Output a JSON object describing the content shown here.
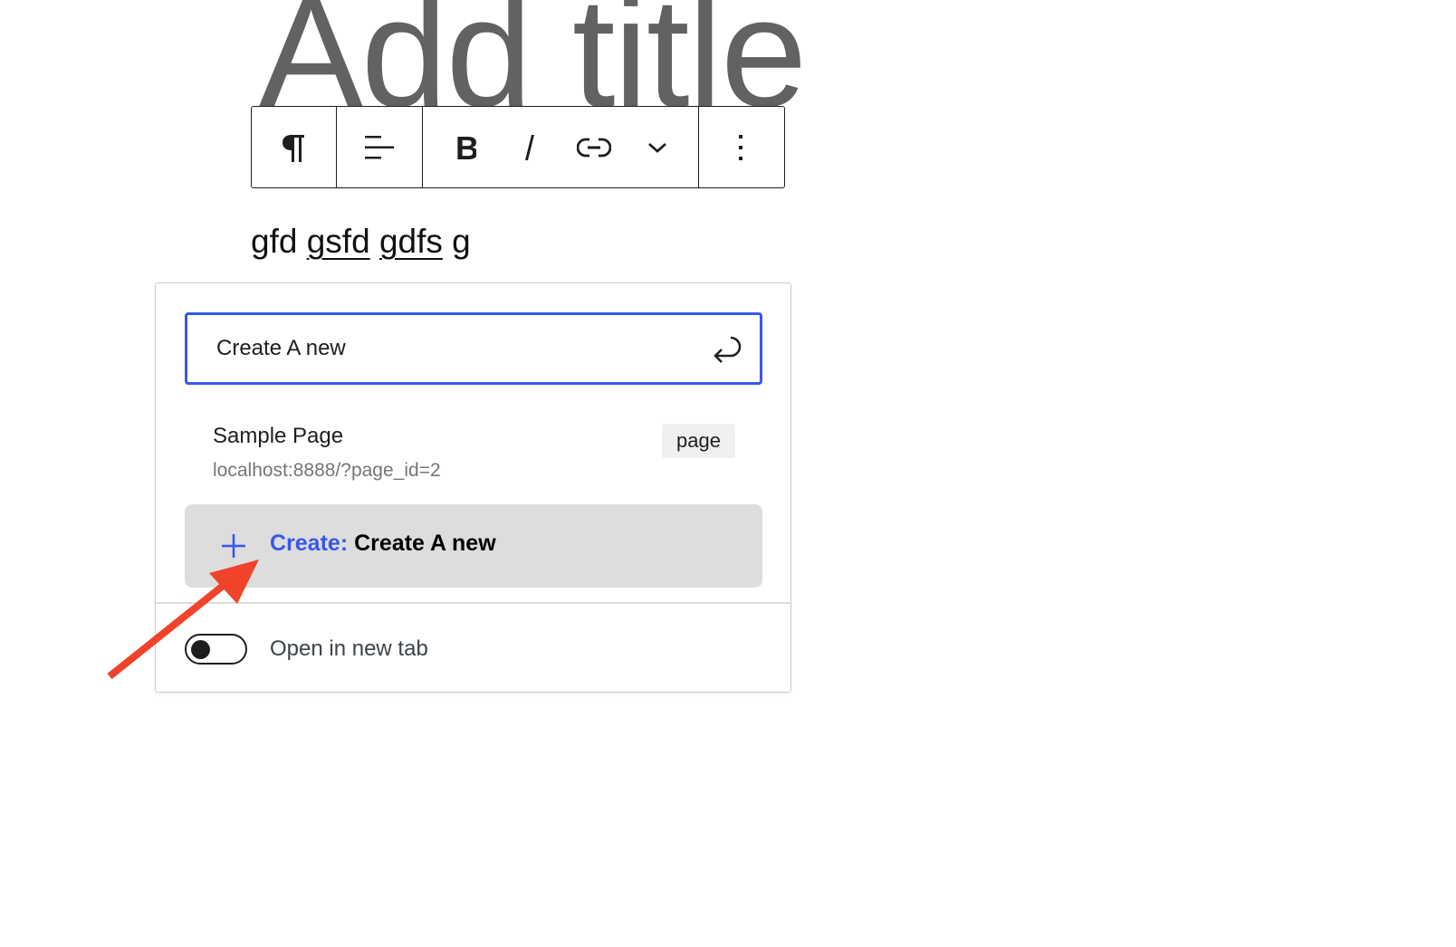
{
  "editor": {
    "title_placeholder": "Add title",
    "paragraph": {
      "segments": [
        {
          "text": "gfd ",
          "link": false
        },
        {
          "text": "gsfd",
          "link": true
        },
        {
          "text": " ",
          "link": false
        },
        {
          "text": "gdfs",
          "link": true
        },
        {
          "text": " g",
          "link": false
        }
      ]
    }
  },
  "toolbar": {
    "groups": [
      {
        "items": [
          {
            "icon": "paragraph-icon",
            "label": "Paragraph"
          }
        ]
      },
      {
        "items": [
          {
            "icon": "align-left-icon",
            "label": "Align text"
          }
        ]
      },
      {
        "items": [
          {
            "icon": "bold-icon",
            "label": "Bold"
          },
          {
            "icon": "italic-icon",
            "label": "Italic"
          },
          {
            "icon": "link-icon",
            "label": "Link"
          },
          {
            "icon": "chevron-down-icon",
            "label": "More"
          }
        ]
      },
      {
        "items": [
          {
            "icon": "more-vertical-icon",
            "label": "Options"
          }
        ]
      }
    ]
  },
  "link_popover": {
    "search": {
      "value": "Create A new",
      "submit_icon": "enter-icon"
    },
    "results": [
      {
        "title": "Sample Page",
        "url": "localhost:8888/?page_id=2",
        "type": "page"
      }
    ],
    "create": {
      "icon": "plus-icon",
      "prefix": "Create:",
      "value": "Create A new"
    },
    "settings": {
      "open_in_new_tab": {
        "label": "Open in new tab",
        "checked": false
      }
    }
  },
  "annotation": {
    "type": "arrow",
    "color": "#f0432a"
  },
  "colors": {
    "accent": "#3858e9",
    "title": "#626262",
    "highlight_bg": "#dddddd"
  }
}
